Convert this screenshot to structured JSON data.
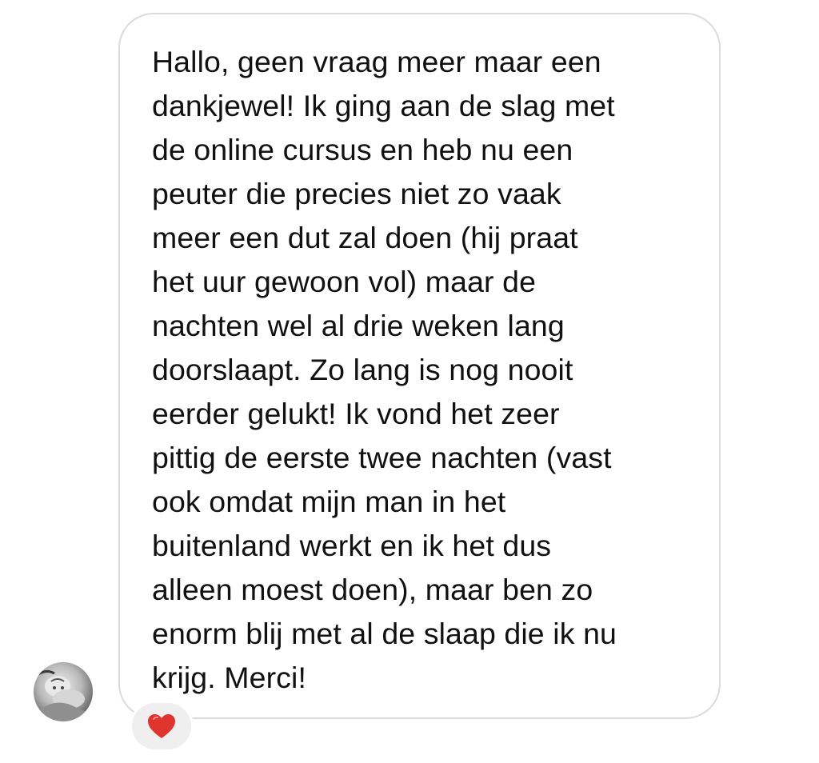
{
  "message": {
    "text": "Hallo, geen vraag meer maar een\ndankjewel! Ik ging aan de slag met\nde online cursus en heb nu een\npeuter die precies niet zo vaak\nmeer een dut zal doen (hij praat\nhet uur gewoon vol) maar de\nnachten wel al drie weken lang\ndoorslaapt. Zo lang is nog nooit\neerder gelukt! Ik vond het zeer\npittig de eerste twee nachten (vast\nook omdat mijn man in het\nbuitenland werkt en ik het dus\nalleen moest doen), maar ben zo\nenorm blij met al de slaap die ik nu\nkrijg. Merci!",
    "reaction_icon": "heart-icon",
    "reaction_color": "#e0342f",
    "bubble_border_color": "#dbdbdb",
    "reaction_background": "#efefef"
  },
  "sender": {
    "avatar_icon": "avatar"
  }
}
